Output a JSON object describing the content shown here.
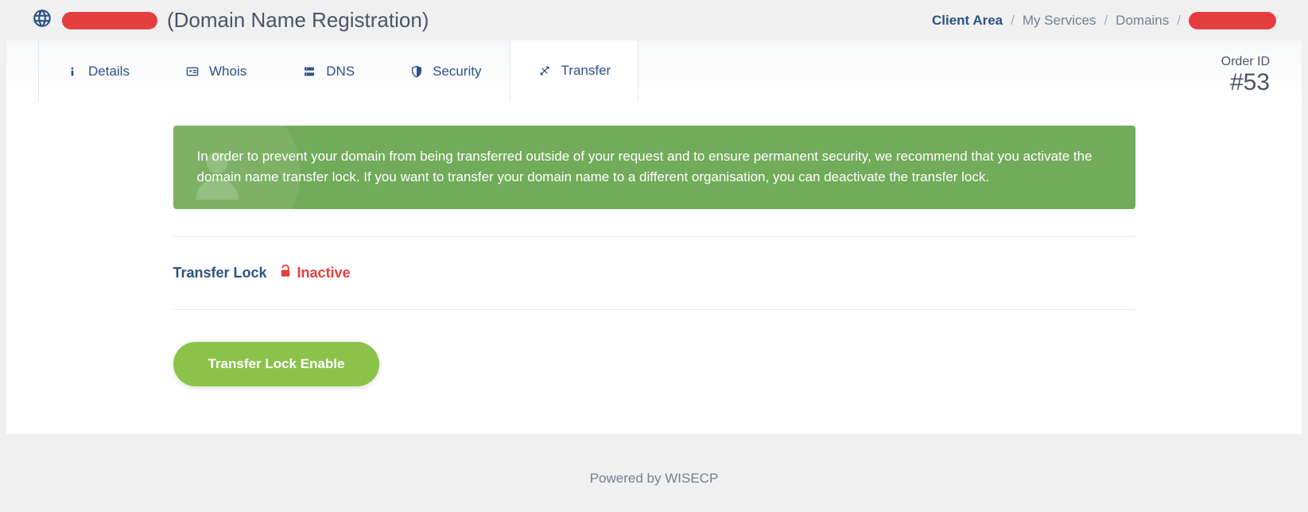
{
  "header": {
    "title_suffix": "(Domain Name Registration)"
  },
  "breadcrumb": {
    "client_area": "Client Area",
    "my_services": "My Services",
    "domains": "Domains"
  },
  "tabs": {
    "details": "Details",
    "whois": "Whois",
    "dns": "DNS",
    "security": "Security",
    "transfer": "Transfer"
  },
  "order": {
    "label": "Order ID",
    "value": "#53"
  },
  "banner": {
    "text": "In order to prevent your domain from being transferred outside of your request and to ensure permanent security, we recommend that you activate the domain name transfer lock. If you want to transfer your domain name to a different organisation, you can deactivate the transfer lock."
  },
  "transfer_lock": {
    "label": "Transfer Lock",
    "status": "Inactive",
    "button": "Transfer Lock Enable"
  },
  "footer": {
    "text": "Powered by WISECP"
  }
}
